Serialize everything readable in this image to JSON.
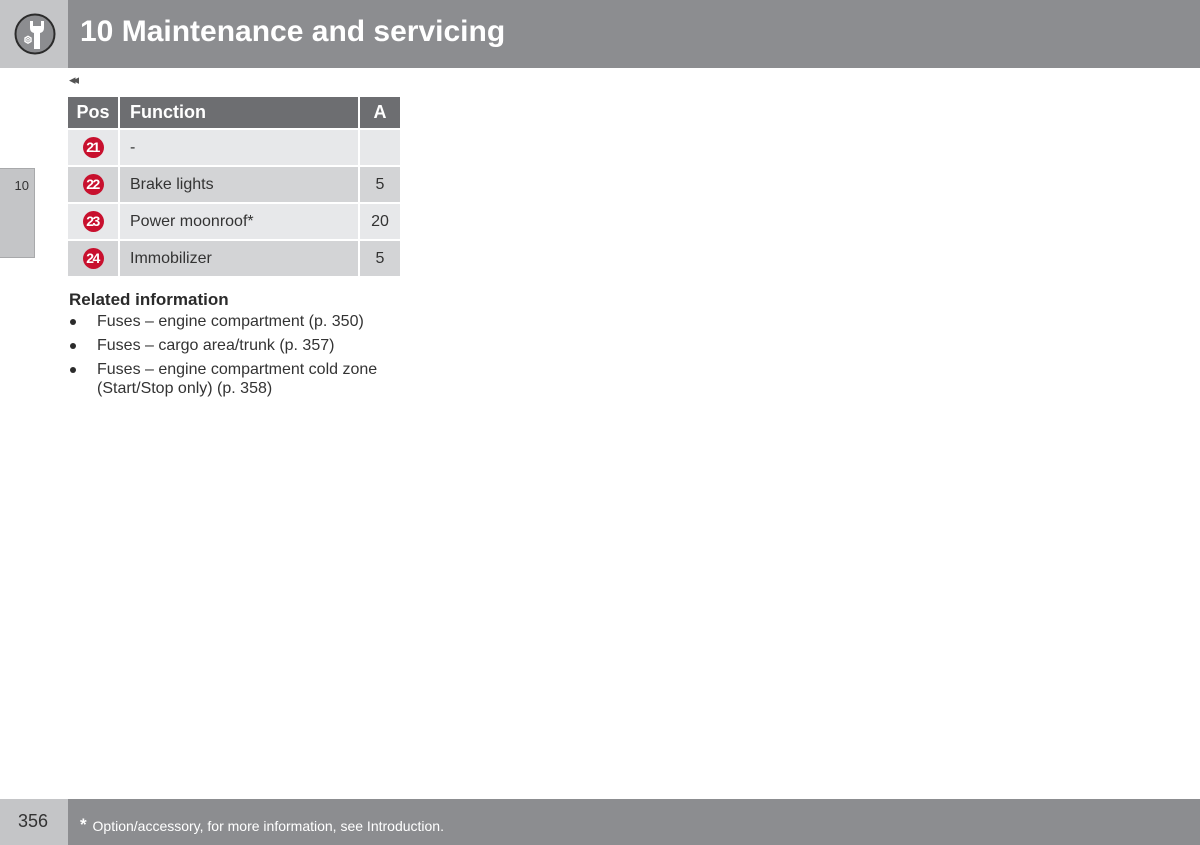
{
  "header": {
    "chapter_icon": "wrench-nut-icon",
    "title": "10 Maintenance and servicing"
  },
  "side_tab": {
    "label": "10"
  },
  "continued_marker": "◂◂",
  "fuse_table": {
    "columns": [
      "Pos",
      "Function",
      "A"
    ],
    "rows": [
      {
        "pos": "21",
        "function": "-",
        "amperage": ""
      },
      {
        "pos": "22",
        "function": "Brake lights",
        "amperage": "5"
      },
      {
        "pos": "23",
        "function": "Power moonroof*",
        "amperage": "20"
      },
      {
        "pos": "24",
        "function": "Immobilizer",
        "amperage": "5"
      }
    ]
  },
  "related": {
    "title": "Related information",
    "items": [
      "Fuses – engine compartment (p. 350)",
      "Fuses – cargo area/trunk (p. 357)",
      "Fuses – engine compartment cold zone (Start/Stop only) (p. 358)"
    ]
  },
  "footer": {
    "page_number": "356",
    "note_star": "*",
    "note": "Option/accessory, for more information, see Introduction."
  },
  "colors": {
    "header_bar": "#8c8d90",
    "header_side": "#c4c5c7",
    "table_header": "#6d6e71",
    "row_light": "#e7e8ea",
    "row_dark": "#d3d4d6",
    "position_badge": "#c8102e"
  }
}
